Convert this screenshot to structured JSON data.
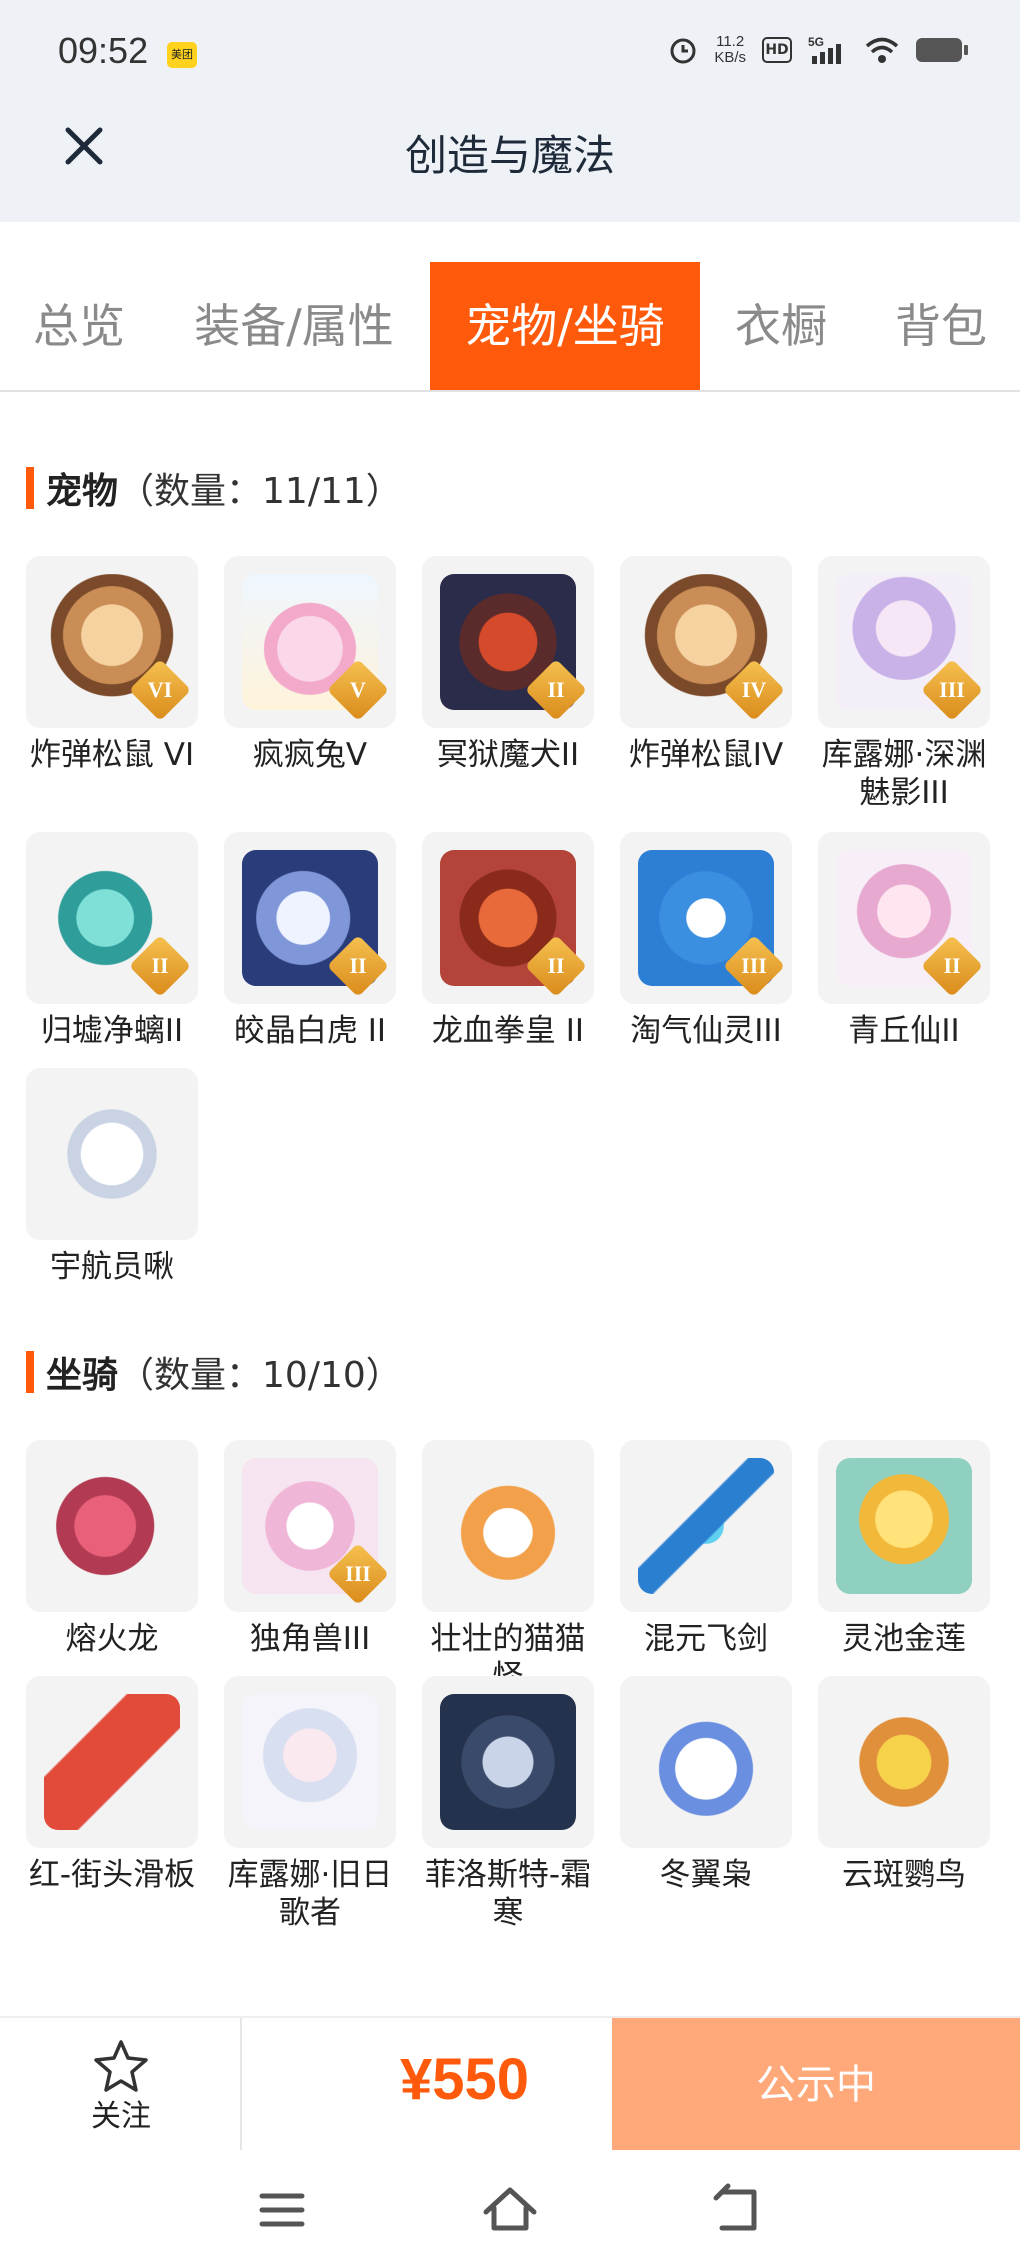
{
  "status": {
    "time": "09:52",
    "app_badge": "美团",
    "speed_value": "11.2",
    "speed_unit": "KB/s",
    "hd": "HD",
    "network": "5G"
  },
  "header": {
    "title": "创造与魔法"
  },
  "tabs": [
    {
      "label": "总览",
      "active": false
    },
    {
      "label": "装备/属性",
      "active": false
    },
    {
      "label": "宠物/坐骑",
      "active": true
    },
    {
      "label": "衣橱",
      "active": false
    },
    {
      "label": "背包",
      "active": false
    }
  ],
  "pets": {
    "title": "宠物",
    "count": "（数量：11/11）",
    "items": [
      {
        "name": "炸弹松鼠 VI",
        "rank": "VI",
        "icon": "squirrel-icon"
      },
      {
        "name": "疯疯兔V",
        "rank": "V",
        "icon": "rabbit-icon"
      },
      {
        "name": "冥狱魔犬II",
        "rank": "II",
        "icon": "hellhound-icon"
      },
      {
        "name": "炸弹松鼠IV",
        "rank": "IV",
        "icon": "squirrel-icon"
      },
      {
        "name": "库露娜·深渊魅影III",
        "rank": "III",
        "icon": "fairy-icon"
      },
      {
        "name": "归墟净螭II",
        "rank": "II",
        "icon": "dragon-icon"
      },
      {
        "name": "皎晶白虎 II",
        "rank": "II",
        "icon": "tiger-icon"
      },
      {
        "name": "龙血拳皇 II",
        "rank": "II",
        "icon": "beast-icon"
      },
      {
        "name": "淘气仙灵III",
        "rank": "III",
        "icon": "puppy-icon"
      },
      {
        "name": "青丘仙II",
        "rank": "II",
        "icon": "fox-fairy-icon"
      },
      {
        "name": "宇航员啾",
        "rank": "",
        "icon": "astronaut-icon"
      }
    ]
  },
  "mounts": {
    "title": "坐骑",
    "count": "（数量：10/10）",
    "items": [
      {
        "name": "熔火龙",
        "rank": "",
        "icon": "fire-dragon-icon"
      },
      {
        "name": "独角兽III",
        "rank": "III",
        "icon": "unicorn-icon"
      },
      {
        "name": "壮壮的猫猫怪",
        "rank": "",
        "icon": "cat-icon"
      },
      {
        "name": "混元飞剑",
        "rank": "",
        "icon": "sword-icon"
      },
      {
        "name": "灵池金莲",
        "rank": "",
        "icon": "lotus-icon"
      },
      {
        "name": "红-街头滑板",
        "rank": "",
        "icon": "skateboard-icon"
      },
      {
        "name": "库露娜·旧日歌者",
        "rank": "",
        "icon": "singer-icon"
      },
      {
        "name": "菲洛斯特-霜寒",
        "rank": "",
        "icon": "warrior-icon"
      },
      {
        "name": "冬翼枭",
        "rank": "",
        "icon": "owl-icon"
      },
      {
        "name": "云斑鹦鸟",
        "rank": "",
        "icon": "parrot-icon"
      }
    ]
  },
  "bottom": {
    "follow_label": "关注",
    "price": "¥550",
    "status_button": "公示中"
  },
  "colors": {
    "accent": "#ff5a0c",
    "header_bg": "#eef2f7",
    "button_disabled": "#ffa879"
  }
}
